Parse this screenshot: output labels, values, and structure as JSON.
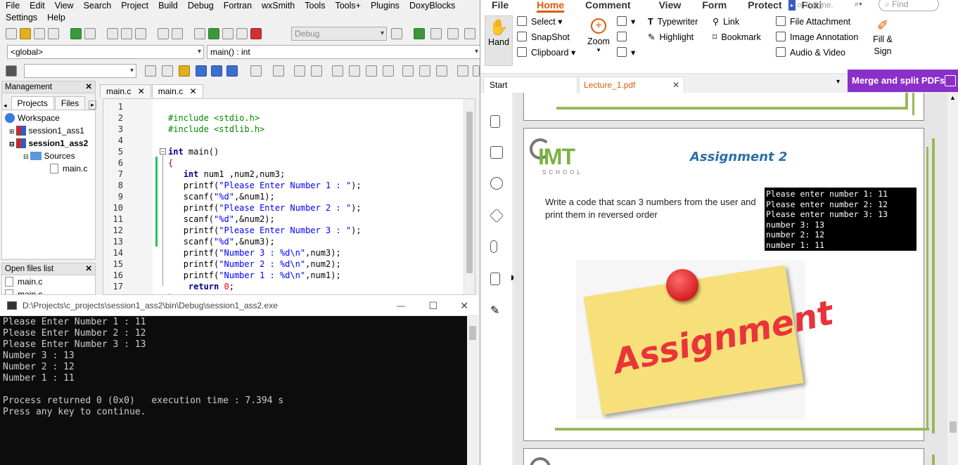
{
  "codeblocks": {
    "menu_row1": [
      "File",
      "Edit",
      "View",
      "Search",
      "Project",
      "Build",
      "Debug",
      "Fortran",
      "wxSmith",
      "Tools",
      "Tools+",
      "Plugins",
      "DoxyBlocks"
    ],
    "menu_row2": [
      "Settings",
      "Help"
    ],
    "build_target": "Debug",
    "scope_combo": "<global>",
    "function_combo": "main() : int",
    "search_combo": "",
    "management": {
      "title": "Management",
      "close": "✕",
      "tabs": [
        "Projects",
        "Files"
      ],
      "tree": [
        "Workspace",
        "session1_ass1",
        "session1_ass2",
        "Sources",
        "main.c"
      ]
    },
    "open_files": {
      "title": "Open files list",
      "close": "✕",
      "items": [
        "main.c",
        "main.c"
      ]
    },
    "editor_tabs": [
      {
        "label": "main.c",
        "close": "✕"
      },
      {
        "label": "main.c",
        "close": "✕"
      }
    ],
    "line_numbers": [
      "1",
      "2",
      "3",
      "4",
      "5",
      "6",
      "7",
      "8",
      "9",
      "10",
      "11",
      "12",
      "13",
      "14",
      "15",
      "16",
      "17"
    ],
    "code": {
      "l1": "#include <stdio.h>",
      "l2": "#include <stdlib.h>",
      "l4_kw": "int",
      "l4_rest": " main()",
      "l5": "{",
      "l6_kw": "int",
      "l6_rest": " num1 ,num2,num3;",
      "l7_fn": "printf(",
      "l7_str": "\"Please Enter Number 1 : \"",
      "l7_end": ");",
      "l8_fn": "scanf(",
      "l8_str": "\"%d\"",
      "l8_end": ",&num1);",
      "l9_fn": "printf(",
      "l9_str": "\"Please Enter Number 2 : \"",
      "l9_end": ");",
      "l10_fn": "scanf(",
      "l10_str": "\"%d\"",
      "l10_end": ",&num2);",
      "l11_fn": "printf(",
      "l11_str": "\"Please Enter Number 3 : \"",
      "l11_end": ");",
      "l12_fn": "scanf(",
      "l12_str": "\"%d\"",
      "l12_end": ",&num3);",
      "l13_fn": "printf(",
      "l13_str": "\"Number 3 : %d\\n\"",
      "l13_end": ",num3);",
      "l14_fn": "printf(",
      "l14_str": "\"Number 2 : %d\\n\"",
      "l14_end": ",num2);",
      "l15_fn": "printf(",
      "l15_str": "\"Number 1 : %d\\n\"",
      "l15_end": ",num1);",
      "l16_kw": "return",
      "l16_num": "0",
      "l16_end": ";",
      "l17": "}"
    }
  },
  "console": {
    "title": "D:\\Projects\\c_projects\\session1_ass2\\bin\\Debug\\session1_ass2.exe",
    "minimize": "—",
    "maximize": "☐",
    "close": "✕",
    "output": "Please Enter Number 1 : 11\nPlease Enter Number 2 : 12\nPlease Enter Number 3 : 13\nNumber 3 : 13\nNumber 2 : 12\nNumber 1 : 11\n\nProcess returned 0 (0x0)   execution time : 7.394 s\nPress any key to continue."
  },
  "foxit": {
    "ribbon_tabs": [
      "File",
      "Home",
      "Comment",
      "View",
      "Form",
      "Protect",
      "Foxi"
    ],
    "tell_me_placeholder": "Tell me.",
    "find_placeholder": "Find",
    "ribbon": {
      "hand": "Hand",
      "select": "Select",
      "snapshot": "SnapShot",
      "clipboard": "Clipboard",
      "zoom": "Zoom",
      "typewriter": "Typewriter",
      "highlight": "Highlight",
      "link": "Link",
      "bookmark": "Bookmark",
      "file_attachment": "File Attachment",
      "image_annotation": "Image Annotation",
      "audio_video": "Audio & Video",
      "fill_sign_1": "Fill &",
      "fill_sign_2": "Sign"
    },
    "doc_tabs": [
      {
        "label": "Start"
      },
      {
        "label": "Lecture_1.pdf",
        "close": "✕"
      }
    ],
    "merge_banner": "Merge and split PDFs",
    "pdf": {
      "logo_main": "IMT",
      "logo_sub": "SCHOOL",
      "title": "Assignment 2",
      "body": "Write a code that scan 3 numbers from the user and print them in reversed order",
      "terminal": "Please enter number 1: 11\nPlease enter number 2: 12\nPlease enter number 3: 13\nnumber 3: 13\nnumber 2: 12\nnumber 1: 11",
      "note_text": "Assignment"
    }
  }
}
